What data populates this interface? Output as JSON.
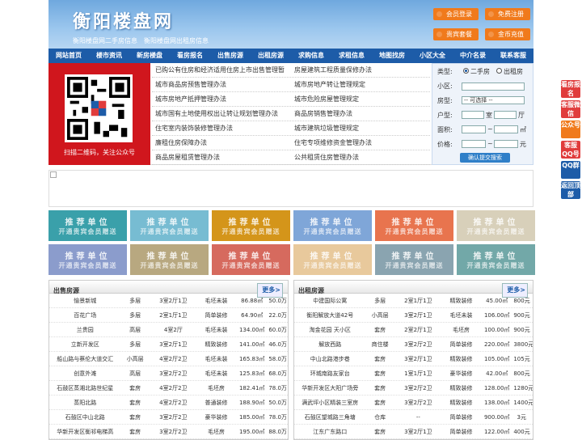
{
  "header": {
    "logo": "衡阳楼盘网",
    "sub": "衡阳楼盘网二手房信息　衡阳楼盘网出租房信息",
    "btns": [
      "会员登录",
      "免费注册",
      "贵宾套餐",
      "金币充值"
    ]
  },
  "nav": [
    "网站首页",
    "楼市资讯",
    "新房楼盘",
    "看房报名",
    "出售房源",
    "出租房源",
    "求购信息",
    "求租信息",
    "地图找房",
    "小区大全",
    "中介名录",
    "联系客服"
  ],
  "qr_caption": "扫描二维码，关注公众号",
  "links": [
    [
      "已购公有住房和经济适用住房上市出售管理暂",
      "房屋建筑工程质量保修办法"
    ],
    [
      "城市商品房预售管理办法",
      "城市房地产转让管理规定"
    ],
    [
      "城市房地产抵押管理办法",
      "城市危险房屋管理规定"
    ],
    [
      "城市国有土地使用权出让转让规划管理办法",
      "商品房销售管理办法"
    ],
    [
      "住宅室内装饰装修管理办法",
      "城市建筑垃圾管理规定"
    ],
    [
      "廉租住房保障办法",
      "住宅专项维修资金管理办法"
    ],
    [
      "商品房屋租赁管理办法",
      "公共租赁住房管理办法"
    ]
  ],
  "search": {
    "type_label": "类型:",
    "opt1": "二手房",
    "opt2": "出租房",
    "district": "小区:",
    "htype": "房型:",
    "htype_val": "-- 可选择 --",
    "layout": "户型:",
    "room": "室",
    "hall": "厅",
    "area": "面积:",
    "price": "价格:",
    "to": "~",
    "sqm": "㎡",
    "yuan": "元",
    "submit": "确认提交搜索"
  },
  "rec_title": "推荐单位",
  "rec_sub": "开通贵宾会员赠送",
  "rec_colors": [
    "#3aa0aa",
    "#77bcd2",
    "#d4951a",
    "#7fa6d8",
    "#e8744e",
    "#d8d0ba",
    "#8b9ccc",
    "#b8a880",
    "#d66a5e",
    "#e8c99c",
    "#8aa4b0",
    "#72a8a8"
  ],
  "sale": {
    "title": "出售房源",
    "more": "更多>",
    "rows": [
      [
        "愉景新城",
        "多层",
        "3室2厅1卫",
        "毛坯未装",
        "86.88㎡",
        "50.0万"
      ],
      [
        "百花广场",
        "多层",
        "2室1厅1卫",
        "简单装修",
        "64.90㎡",
        "22.0万"
      ],
      [
        "兰贵园",
        "高层",
        "4室2厅",
        "毛坯未装",
        "134.00㎡",
        "60.0万"
      ],
      [
        "立新开发区",
        "多层",
        "3室2厅1卫",
        "精致装修",
        "141.00㎡",
        "46.0万"
      ],
      [
        "船山路与蔡伦大道交汇",
        "小高层",
        "4室2厅2卫",
        "毛坯未装",
        "165.83㎡",
        "58.0万"
      ],
      [
        "创意外滩",
        "高层",
        "3室2厅2卫",
        "毛坯未装",
        "125.83㎡",
        "68.0万"
      ],
      [
        "石鼓区蒸湘北路世纪星",
        "套房",
        "4室2厅2卫",
        "毛坯房",
        "182.41㎡",
        "78.0万"
      ],
      [
        "蒸阳北路",
        "套房",
        "4室2厅2卫",
        "普通装修",
        "188.90㎡",
        "50.0万"
      ],
      [
        "石鼓区中山北路",
        "套房",
        "3室2厅2卫",
        "豪华装修",
        "185.00㎡",
        "78.0万"
      ],
      [
        "华新开发区衡祁电梯高",
        "套房",
        "3室2厅2卫",
        "毛坯房",
        "195.00㎡",
        "88.0万"
      ]
    ]
  },
  "rent": {
    "title": "出租房源",
    "more": "更多>",
    "rows": [
      [
        "中建国际公寓",
        "多层",
        "2室1厅1卫",
        "精致装修",
        "45.00㎡",
        "800元"
      ],
      [
        "衡阳解放大道42号",
        "小高层",
        "3室2厅1卫",
        "毛坯未装",
        "106.00㎡",
        "900元"
      ],
      [
        "淘金花园 天小区",
        "套房",
        "2室2厅1卫",
        "毛坯房",
        "100.00㎡",
        "900元"
      ],
      [
        "解放西路",
        "商住楼",
        "3室2厅2卫",
        "简单装修",
        "220.00㎡",
        "3800元"
      ],
      [
        "中山北路港步巷",
        "套房",
        "3室2厅1卫",
        "精致装修",
        "105.00㎡",
        "105元"
      ],
      [
        "环城南路友家台",
        "套房",
        "1室1厅1卫",
        "豪华装修",
        "42.00㎡",
        "800元"
      ],
      [
        "华新开发区大阳广场旁",
        "套房",
        "3室2厅2卫",
        "精致装修",
        "128.00㎡",
        "1280元"
      ],
      [
        "满武坪小区精装三室房",
        "套房",
        "3室2厅2卫",
        "精致装修",
        "138.00㎡",
        "1400元"
      ],
      [
        "石鼓区望城路三角塘",
        "仓库",
        "--",
        "简单装修",
        "900.00㎡",
        "3元"
      ],
      [
        "江东广东路口",
        "套房",
        "3室2厅1卫",
        "简单装修",
        "122.00㎡",
        "400元"
      ]
    ]
  },
  "sidebar": [
    {
      "label": "看房报名",
      "color": "#e03c3c"
    },
    {
      "label": "客服微信",
      "color": "#e03c3c"
    },
    {
      "label": "公众号",
      "color": "#f07a1c"
    },
    {
      "label": "客服QQ号",
      "color": "#e03c3c"
    },
    {
      "label": "QQ群",
      "color": "#1d5ca8"
    },
    {
      "label": "返回顶部",
      "color": "#1d5ca8"
    }
  ]
}
